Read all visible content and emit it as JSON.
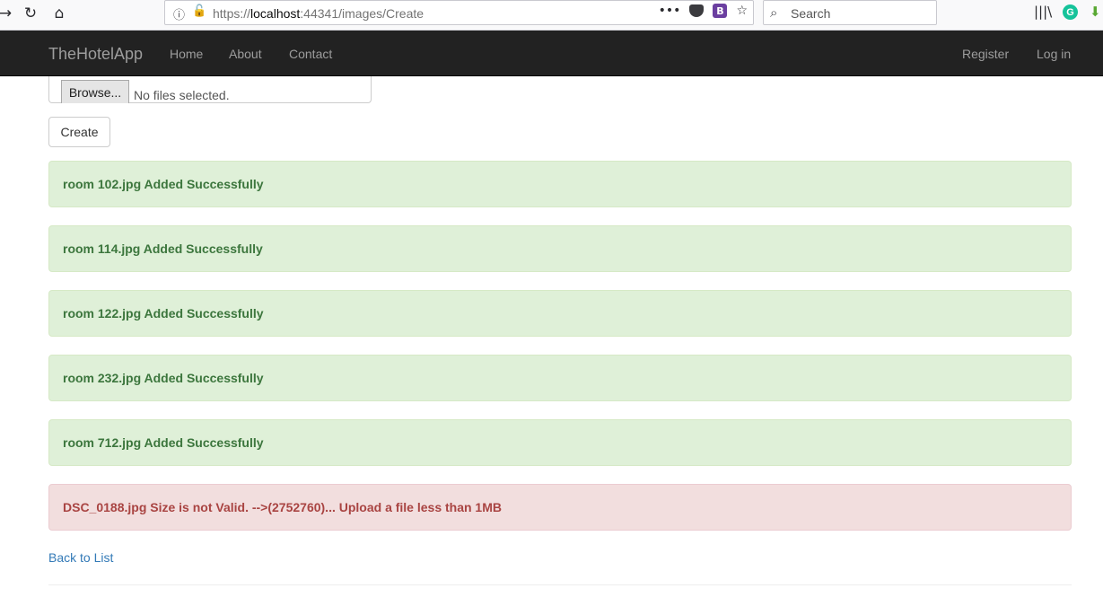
{
  "browser": {
    "url_prefix": "https://",
    "url_host": "localhost",
    "url_path": ":44341/images/Create",
    "search_placeholder": "Search",
    "bitwarden_badge": "B",
    "grammarly_badge": "G"
  },
  "navbar": {
    "brand": "TheHotelApp",
    "links": [
      "Home",
      "About",
      "Contact"
    ],
    "right_links": [
      "Register",
      "Log in"
    ]
  },
  "form": {
    "browse_label": "Browse...",
    "file_status": "No files selected.",
    "create_label": "Create"
  },
  "messages": [
    {
      "text": "room 102.jpg Added Successfully",
      "status": "success"
    },
    {
      "text": "room 114.jpg Added Successfully",
      "status": "success"
    },
    {
      "text": "room 122.jpg Added Successfully",
      "status": "success"
    },
    {
      "text": "room 232.jpg Added Successfully",
      "status": "success"
    },
    {
      "text": "room 712.jpg Added Successfully",
      "status": "success"
    },
    {
      "text": "DSC_0188.jpg Size is not Valid. -->(2752760)... Upload a file less than 1MB",
      "status": "danger"
    }
  ],
  "footer": {
    "back_link": "Back to List"
  },
  "colors": {
    "navbar_bg": "#222222",
    "success_bg": "#dff0d8",
    "success_text": "#3c763d",
    "danger_bg": "#f2dede",
    "danger_text": "#a94442",
    "link": "#337ab7"
  }
}
